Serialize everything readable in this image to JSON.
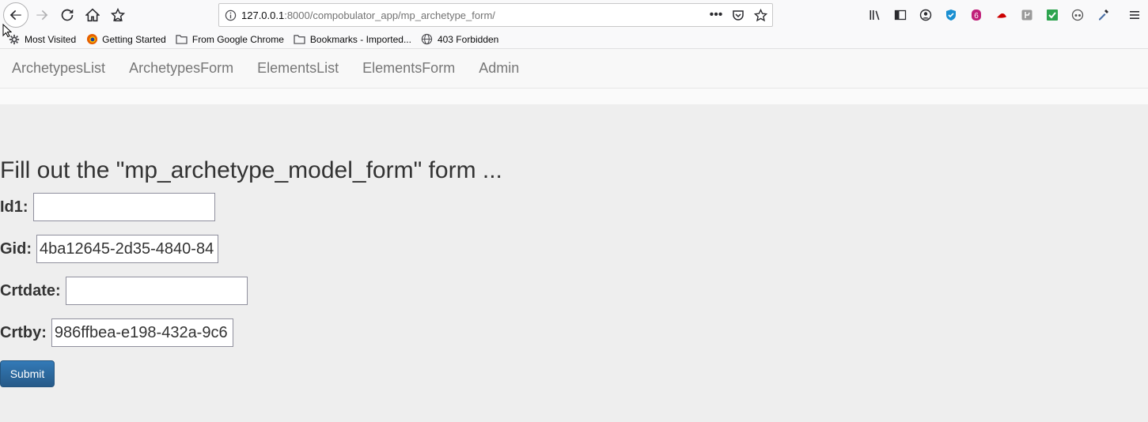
{
  "browser": {
    "url_host": "127.0.0.1",
    "url_path": ":8000/compobulator_app/mp_archetype_form/",
    "bookmarks": [
      {
        "label": "Most Visited",
        "icon": "gear-icon"
      },
      {
        "label": "Getting Started",
        "icon": "firefox-icon"
      },
      {
        "label": "From Google Chrome",
        "icon": "folder-icon"
      },
      {
        "label": "Bookmarks - Imported...",
        "icon": "folder-icon"
      },
      {
        "label": "403 Forbidden",
        "icon": "globe-icon"
      }
    ]
  },
  "nav": {
    "items": [
      {
        "label": "ArchetypesList"
      },
      {
        "label": "ArchetypesForm"
      },
      {
        "label": "ElementsList"
      },
      {
        "label": "ElementsForm"
      },
      {
        "label": "Admin"
      }
    ]
  },
  "form": {
    "title": "Fill out the \"mp_archetype_model_form\" form ...",
    "fields": {
      "id1": {
        "label": "Id1:",
        "value": ""
      },
      "gid": {
        "label": "Gid:",
        "value": "4ba12645-2d35-4840-84"
      },
      "crtdate": {
        "label": "Crtdate:",
        "value": ""
      },
      "crtby": {
        "label": "Crtby:",
        "value": "986ffbea-e198-432a-9c6"
      }
    },
    "submit_label": "Submit"
  },
  "colors": {
    "submit": "#337ab7",
    "background": "#eeeeee",
    "navbar": "#f8f8f8"
  }
}
